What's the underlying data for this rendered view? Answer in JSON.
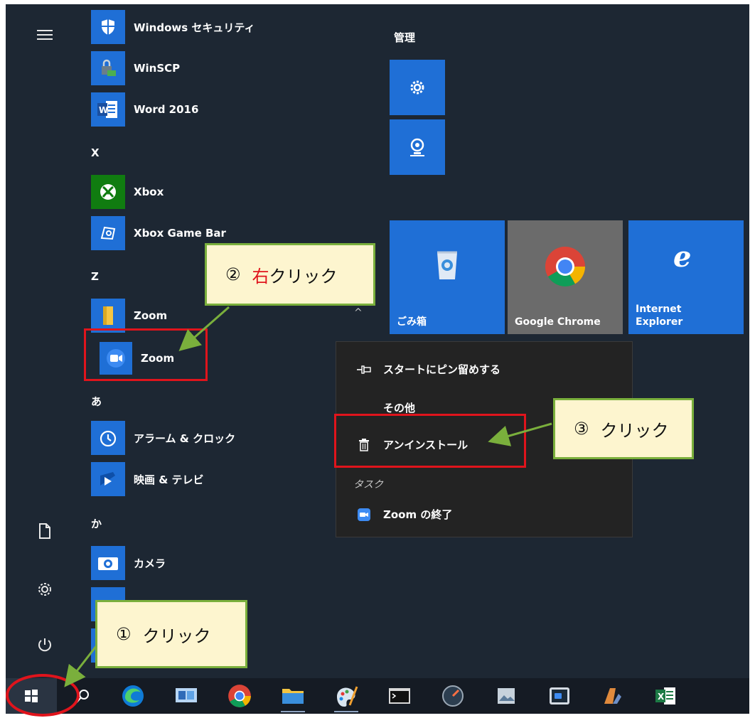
{
  "applist": {
    "items": [
      {
        "label": "Windows セキュリティ",
        "icon": "shield-icon"
      },
      {
        "label": "WinSCP",
        "icon": "winscp-icon"
      },
      {
        "label": "Word 2016",
        "icon": "word-icon"
      },
      {
        "letter": "X"
      },
      {
        "label": "Xbox",
        "icon": "xbox-icon"
      },
      {
        "label": "Xbox Game Bar",
        "icon": "xbox-game-bar-icon"
      },
      {
        "letter": "Z"
      },
      {
        "label": "Zoom",
        "icon": "folder-icon"
      },
      {
        "label": "Zoom",
        "icon": "zoom-icon"
      },
      {
        "letter": "あ"
      },
      {
        "label": "アラーム & クロック",
        "icon": "alarm-clock-icon"
      },
      {
        "label": "映画 & テレビ",
        "icon": "movies-tv-icon"
      },
      {
        "letter": "か"
      },
      {
        "label": "カメラ",
        "icon": "camera-icon"
      }
    ]
  },
  "tiles": {
    "group_title": "管理",
    "recycle_bin": "ごみ箱",
    "chrome": "Google Chrome",
    "ie_line1": "Internet",
    "ie_line2": "Explorer"
  },
  "context_menu": {
    "pin": "スタートにピン留めする",
    "more": "その他",
    "uninstall": "アンインストール",
    "section_task": "タスク",
    "zoom_exit": "Zoom の終了"
  },
  "callouts": {
    "step1_num": "①",
    "step1_text": "クリック",
    "step2_num": "②",
    "step2_red": "右",
    "step2_text": "クリック",
    "step3_num": "③",
    "step3_text": "クリック"
  },
  "colors": {
    "background": "#1d2733",
    "tile_blue": "#1f6fd6",
    "chrome_tile": "#6b6b6b",
    "annotation_red": "#e0141c",
    "annotation_green": "#7aaf3c",
    "callout_fill": "#fdf5cf"
  }
}
